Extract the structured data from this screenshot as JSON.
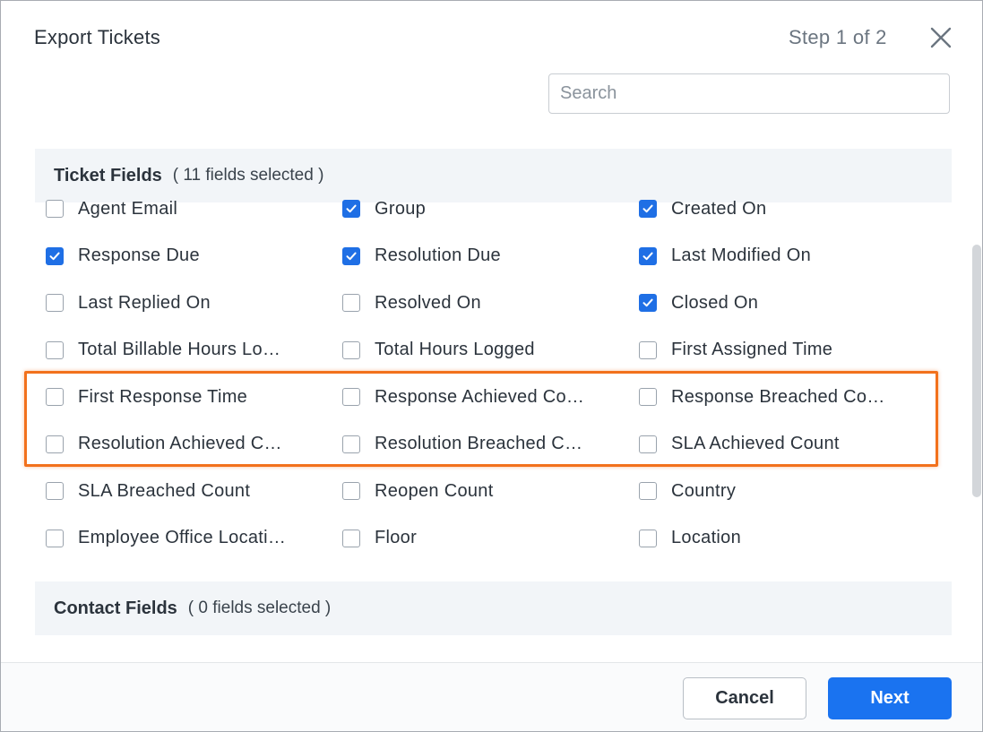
{
  "dialog": {
    "title": "Export Tickets",
    "step": "Step 1 of 2",
    "close_icon": "close-icon"
  },
  "search": {
    "placeholder": "Search",
    "value": ""
  },
  "sections": [
    {
      "name": "Ticket Fields",
      "count_text": "( 11 fields selected )"
    },
    {
      "name": "Contact Fields",
      "count_text": "( 0 fields selected )"
    }
  ],
  "ticket_fields": [
    {
      "label": "Agent Email",
      "checked": false
    },
    {
      "label": "Group",
      "checked": true
    },
    {
      "label": "Created On",
      "checked": true
    },
    {
      "label": "Response Due",
      "checked": true
    },
    {
      "label": "Resolution Due",
      "checked": true
    },
    {
      "label": "Last Modified On",
      "checked": true
    },
    {
      "label": "Last Replied On",
      "checked": false
    },
    {
      "label": "Resolved On",
      "checked": false
    },
    {
      "label": "Closed On",
      "checked": true
    },
    {
      "label": "Total Billable Hours Lo…",
      "checked": false
    },
    {
      "label": "Total Hours Logged",
      "checked": false
    },
    {
      "label": "First Assigned Time",
      "checked": false
    },
    {
      "label": "First Response Time",
      "checked": false
    },
    {
      "label": "Response Achieved Co…",
      "checked": false
    },
    {
      "label": "Response Breached Co…",
      "checked": false
    },
    {
      "label": "Resolution Achieved C…",
      "checked": false
    },
    {
      "label": "Resolution Breached C…",
      "checked": false
    },
    {
      "label": "SLA Achieved Count",
      "checked": false
    },
    {
      "label": "SLA Breached Count",
      "checked": false
    },
    {
      "label": "Reopen Count",
      "checked": false
    },
    {
      "label": "Country",
      "checked": false
    },
    {
      "label": "Employee Office Locati…",
      "checked": false
    },
    {
      "label": "Floor",
      "checked": false
    },
    {
      "label": "Location",
      "checked": false
    }
  ],
  "footer": {
    "cancel_label": "Cancel",
    "next_label": "Next"
  },
  "colors": {
    "accent": "#1a73f0",
    "checkbox_checked": "#1f6fe5",
    "highlight": "#f2711c",
    "section_bg": "#f2f5f8"
  }
}
